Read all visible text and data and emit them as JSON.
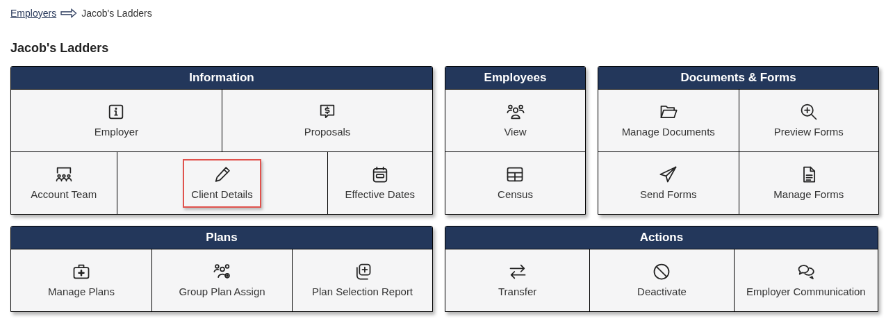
{
  "breadcrumb": {
    "link": "Employers",
    "current": "Jacob's Ladders"
  },
  "heading": "Jacob's Ladders",
  "panels": [
    {
      "title": "Information",
      "rows": [
        [
          {
            "label": "Employer",
            "highlighted": false
          },
          {
            "label": "Proposals",
            "highlighted": false
          }
        ],
        [
          {
            "label": "Account Team",
            "highlighted": false
          },
          {
            "label": "Client Details",
            "highlighted": true
          },
          {
            "label": "Effective Dates",
            "highlighted": false
          }
        ]
      ]
    },
    {
      "title": "Employees",
      "rows": [
        [
          {
            "label": "View",
            "highlighted": false
          }
        ],
        [
          {
            "label": "Census",
            "highlighted": false
          }
        ]
      ]
    },
    {
      "title": "Documents & Forms",
      "rows": [
        [
          {
            "label": "Manage Documents",
            "highlighted": false
          },
          {
            "label": "Preview Forms",
            "highlighted": false
          }
        ],
        [
          {
            "label": "Send Forms",
            "highlighted": false
          },
          {
            "label": "Manage Forms",
            "highlighted": false
          }
        ]
      ]
    },
    {
      "title": "Plans",
      "rows": [
        [
          {
            "label": "Manage Plans",
            "highlighted": false
          },
          {
            "label": "Group Plan Assign",
            "highlighted": false
          },
          {
            "label": "Plan Selection Report",
            "highlighted": false
          }
        ]
      ]
    },
    {
      "title": "Actions",
      "rows": [
        [
          {
            "label": "Transfer",
            "highlighted": false
          },
          {
            "label": "Deactivate",
            "highlighted": false
          },
          {
            "label": "Employer Communication",
            "highlighted": false
          }
        ]
      ]
    }
  ]
}
